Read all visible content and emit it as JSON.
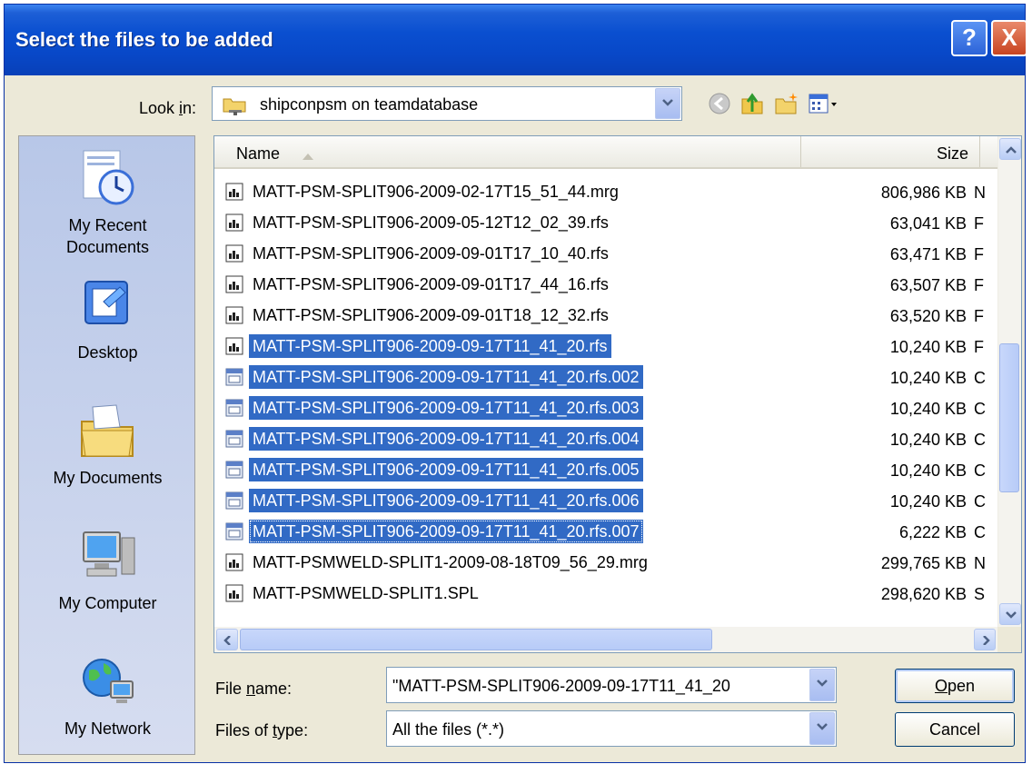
{
  "window": {
    "title": "Select the files to be added",
    "help_label": "?",
    "close_label": "X"
  },
  "look_in": {
    "label_pre": "Look ",
    "label_mnemonic": "i",
    "label_post": "n:",
    "value": "shipconpsm on teamdatabase"
  },
  "places": [
    {
      "label": "My Recent",
      "label2": "Documents",
      "icon": "recent-documents-icon"
    },
    {
      "label": "Desktop",
      "label2": "",
      "icon": "desktop-icon"
    },
    {
      "label": "My Documents",
      "label2": "",
      "icon": "my-documents-icon"
    },
    {
      "label": "My Computer",
      "label2": "",
      "icon": "my-computer-icon"
    },
    {
      "label": "My Network",
      "label2": "",
      "icon": "my-network-icon"
    }
  ],
  "columns": {
    "name": "Name",
    "size": "Size"
  },
  "files": [
    {
      "name": "MATT-PSM-SPLIT906-2009-02-17T15_51_44.mrg",
      "size": "806,986 KB",
      "type": "N",
      "selected": false,
      "icon": "doc-file-icon"
    },
    {
      "name": "MATT-PSM-SPLIT906-2009-05-12T12_02_39.rfs",
      "size": "63,041 KB",
      "type": "F",
      "selected": false,
      "icon": "doc-file-icon"
    },
    {
      "name": "MATT-PSM-SPLIT906-2009-09-01T17_10_40.rfs",
      "size": "63,471 KB",
      "type": "F",
      "selected": false,
      "icon": "doc-file-icon"
    },
    {
      "name": "MATT-PSM-SPLIT906-2009-09-01T17_44_16.rfs",
      "size": "63,507 KB",
      "type": "F",
      "selected": false,
      "icon": "doc-file-icon"
    },
    {
      "name": "MATT-PSM-SPLIT906-2009-09-01T18_12_32.rfs",
      "size": "63,520 KB",
      "type": "F",
      "selected": false,
      "icon": "doc-file-icon"
    },
    {
      "name": "MATT-PSM-SPLIT906-2009-09-17T11_41_20.rfs",
      "size": "10,240 KB",
      "type": "F",
      "selected": true,
      "icon": "doc-file-icon"
    },
    {
      "name": "MATT-PSM-SPLIT906-2009-09-17T11_41_20.rfs.002",
      "size": "10,240 KB",
      "type": "C",
      "selected": true,
      "icon": "generic-file-icon"
    },
    {
      "name": "MATT-PSM-SPLIT906-2009-09-17T11_41_20.rfs.003",
      "size": "10,240 KB",
      "type": "C",
      "selected": true,
      "icon": "generic-file-icon"
    },
    {
      "name": "MATT-PSM-SPLIT906-2009-09-17T11_41_20.rfs.004",
      "size": "10,240 KB",
      "type": "C",
      "selected": true,
      "icon": "generic-file-icon"
    },
    {
      "name": "MATT-PSM-SPLIT906-2009-09-17T11_41_20.rfs.005",
      "size": "10,240 KB",
      "type": "C",
      "selected": true,
      "icon": "generic-file-icon"
    },
    {
      "name": "MATT-PSM-SPLIT906-2009-09-17T11_41_20.rfs.006",
      "size": "10,240 KB",
      "type": "C",
      "selected": true,
      "icon": "generic-file-icon"
    },
    {
      "name": "MATT-PSM-SPLIT906-2009-09-17T11_41_20.rfs.007",
      "size": "6,222 KB",
      "type": "C",
      "selected": true,
      "focused": true,
      "icon": "generic-file-icon"
    },
    {
      "name": "MATT-PSMWELD-SPLIT1-2009-08-18T09_56_29.mrg",
      "size": "299,765 KB",
      "type": "N",
      "selected": false,
      "icon": "doc-file-icon"
    },
    {
      "name": "MATT-PSMWELD-SPLIT1.SPL",
      "size": "298,620 KB",
      "type": "S",
      "selected": false,
      "icon": "doc-file-icon"
    }
  ],
  "file_name": {
    "label_pre": "File ",
    "label_mnemonic": "n",
    "label_post": "ame:",
    "value": "\"MATT-PSM-SPLIT906-2009-09-17T11_41_20"
  },
  "files_of_type": {
    "label_pre": "Files of ",
    "label_mnemonic": "t",
    "label_post": "ype:",
    "value": "All the files (*.*)"
  },
  "buttons": {
    "open_mnemonic": "O",
    "open_rest": "pen",
    "cancel": "Cancel"
  },
  "colors": {
    "selection": "#316ac5",
    "titlebar": "#0a4fd0",
    "dialog_bg": "#ece9d8"
  }
}
